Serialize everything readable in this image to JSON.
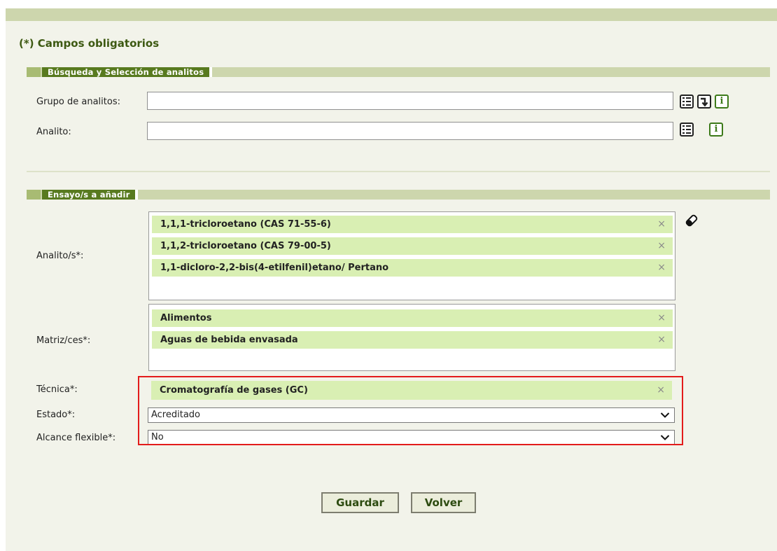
{
  "form": {
    "required_note": "(*) Campos obligatorios"
  },
  "search_section": {
    "title": "Búsqueda y Selección de analitos",
    "group_label": "Grupo de analitos:",
    "group_value": "",
    "analyte_label": "Analito:",
    "analyte_value": ""
  },
  "tests_section": {
    "title": "Ensayo/s a añadir",
    "analytes_label": "Analito/s*:",
    "analytes": [
      "1,1,1-tricloroetano (CAS 71-55-6)",
      "1,1,2-tricloroetano (CAS 79-00-5)",
      "1,1-dicloro-2,2-bis(4-etilfenil)etano/ Pertano"
    ],
    "matrices_label": "Matriz/ces*:",
    "matrices": [
      "Alimentos",
      "Aguas de bebida envasada"
    ],
    "technique_label": "Técnica*:",
    "technique": "Cromatografía de gases (GC)",
    "status_label": "Estado*:",
    "status_value": "Acreditado",
    "flexible_label": "Alcance flexible*:",
    "flexible_value": "No",
    "remove_symbol": "×"
  },
  "buttons": {
    "save": "Guardar",
    "back": "Volver"
  },
  "icons": {
    "list": "list-icon",
    "arrow": "arrow-down-return-icon",
    "info": "info-icon",
    "eraser": "eraser-icon",
    "info_glyph": "i"
  },
  "colors": {
    "panel_background": "#f2f3ea",
    "header_bar": "#cdd6ad",
    "section_title": "#587a1f",
    "tag_background": "#d9efb3",
    "highlight_border": "#e31b1b"
  }
}
